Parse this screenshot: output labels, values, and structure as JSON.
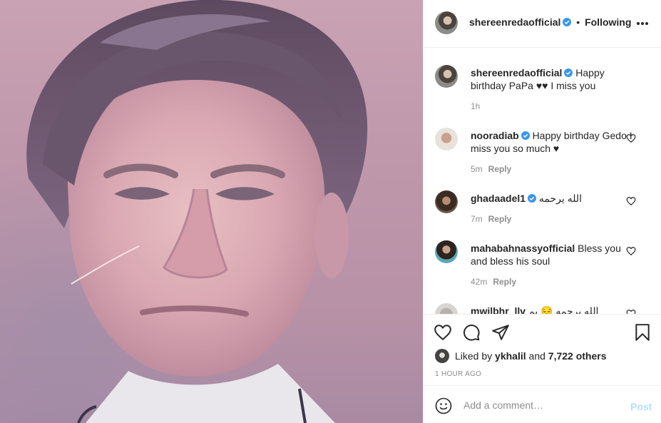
{
  "photo": {
    "description_icon": "portrait-photo"
  },
  "header": {
    "username": "shereenredaofficial",
    "separator": "•",
    "follow_status": "Following"
  },
  "comments": [
    {
      "username": "shereenredaofficial",
      "verified": true,
      "text": "Happy birthday PaPa ♥♥ I miss you",
      "time": "1h",
      "reply": ""
    },
    {
      "username": "nooradiab",
      "verified": true,
      "text": "Happy birthday Gedo I miss you so much ♥",
      "time": "5m",
      "reply": "Reply"
    },
    {
      "username": "ghadaadel1",
      "verified": true,
      "text": "الله يرحمه",
      "time": "7m",
      "reply": "Reply"
    },
    {
      "username": "mahabahnassyofficial",
      "verified": false,
      "text": "Bless you and bless his soul",
      "time": "42m",
      "reply": "Reply"
    },
    {
      "username": "mwilbhr_llv",
      "verified": false,
      "text": "الله يرحمه 😔 يم",
      "time": "",
      "reply": ""
    }
  ],
  "likes": {
    "prefix": "Liked by",
    "user": "ykhalil",
    "connector": "and",
    "others": "7,722 others"
  },
  "timestamp": "1 HOUR AGO",
  "add_comment": {
    "placeholder": "Add a comment…",
    "post_label": "Post"
  },
  "colors": {
    "verified": "#3897f0",
    "post_button": "#b2dffc",
    "meta_text": "#8e8e8e"
  }
}
